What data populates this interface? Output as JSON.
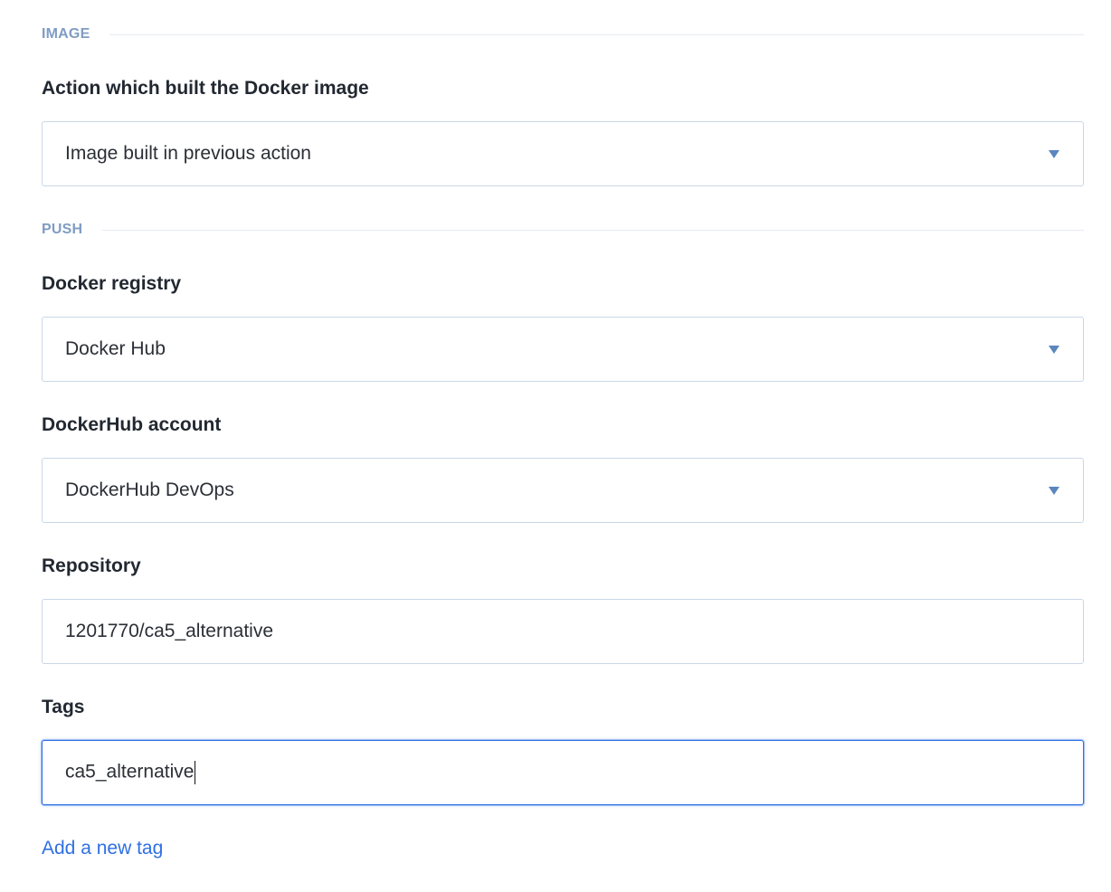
{
  "sections": {
    "image": {
      "title": "IMAGE"
    },
    "push": {
      "title": "PUSH"
    }
  },
  "fields": {
    "action": {
      "label": "Action which built the Docker image",
      "value": "Image built in previous action"
    },
    "registry": {
      "label": "Docker registry",
      "value": "Docker Hub"
    },
    "account": {
      "label": "DockerHub account",
      "value": "DockerHub DevOps"
    },
    "repository": {
      "label": "Repository",
      "value": "1201770/ca5_alternative"
    },
    "tags": {
      "label": "Tags",
      "value": "ca5_alternative"
    }
  },
  "links": {
    "add_tag": "Add a new tag"
  },
  "icons": {
    "dropdown": "chevron-down-icon"
  },
  "colors": {
    "section_title": "#7f9cc3",
    "border": "#c9d7e6",
    "focus": "#2f6fe4",
    "link": "#2f6fe4",
    "caret": "#5a86bd"
  }
}
